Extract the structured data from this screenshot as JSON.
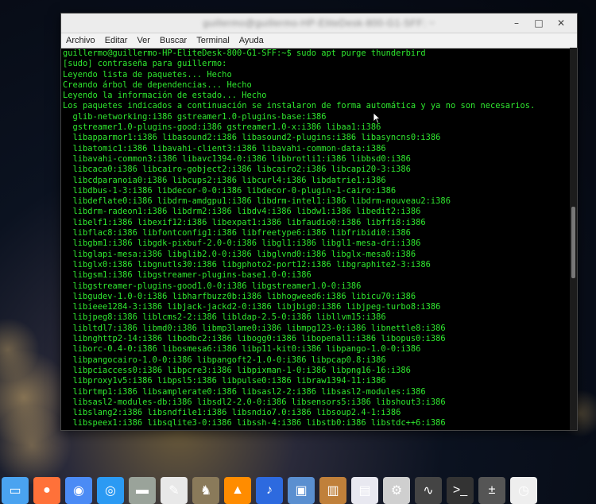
{
  "window": {
    "title_blurred": "guillermo@guillermo-HP-EliteDesk-800-G1-SFF: ~",
    "minimize_glyph": "–",
    "maximize_glyph": "□",
    "close_glyph": "✕"
  },
  "menu": [
    "Archivo",
    "Editar",
    "Ver",
    "Buscar",
    "Terminal",
    "Ayuda"
  ],
  "terminal": {
    "color": "#2fe82f",
    "lines": [
      "guillermo@guillermo-HP-EliteDesk-800-G1-SFF:~$ sudo apt purge thunderbird",
      "[sudo] contraseña para guillermo:",
      "Leyendo lista de paquetes... Hecho",
      "Creando árbol de dependencias... Hecho",
      "Leyendo la información de estado... Hecho",
      "Los paquetes indicados a continuación se instalaron de forma automática y ya no son necesarios.",
      "  glib-networking:i386 gstreamer1.0-plugins-base:i386",
      "  gstreamer1.0-plugins-good:i386 gstreamer1.0-x:i386 libaa1:i386",
      "  libapparmor1:i386 libasound2:i386 libasound2-plugins:i386 libasyncns0:i386",
      "  libatomic1:i386 libavahi-client3:i386 libavahi-common-data:i386",
      "  libavahi-common3:i386 libavc1394-0:i386 libbrotli1:i386 libbsd0:i386",
      "  libcaca0:i386 libcairo-gobject2:i386 libcairo2:i386 libcapi20-3:i386",
      "  libcdparanoia0:i386 libcups2:i386 libcurl4:i386 libdatrie1:i386",
      "  libdbus-1-3:i386 libdecor-0-0:i386 libdecor-0-plugin-1-cairo:i386",
      "  libdeflate0:i386 libdrm-amdgpu1:i386 libdrm-intel1:i386 libdrm-nouveau2:i386",
      "  libdrm-radeon1:i386 libdrm2:i386 libdv4:i386 libdw1:i386 libedit2:i386",
      "  libelf1:i386 libexif12:i386 libexpat1:i386 libfaudio0:i386 libffi8:i386",
      "  libflac8:i386 libfontconfig1:i386 libfreetype6:i386 libfribidi0:i386",
      "  libgbm1:i386 libgdk-pixbuf-2.0-0:i386 libgl1:i386 libgl1-mesa-dri:i386",
      "  libglapi-mesa:i386 libglib2.0-0:i386 libglvnd0:i386 libglx-mesa0:i386",
      "  libglx0:i386 libgnutls30:i386 libgphoto2-port12:i386 libgraphite2-3:i386",
      "  libgsm1:i386 libgstreamer-plugins-base1.0-0:i386",
      "  libgstreamer-plugins-good1.0-0:i386 libgstreamer1.0-0:i386",
      "  libgudev-1.0-0:i386 libharfbuzz0b:i386 libhogweed6:i386 libicu70:i386",
      "  libieee1284-3:i386 libjack-jackd2-0:i386 libjbig0:i386 libjpeg-turbo8:i386",
      "  libjpeg8:i386 liblcms2-2:i386 libldap-2.5-0:i386 libllvm15:i386",
      "  libltdl7:i386 libmd0:i386 libmp3lame0:i386 libmpg123-0:i386 libnettle8:i386",
      "  libnghttp2-14:i386 libodbc2:i386 libogg0:i386 libopenal1:i386 libopus0:i386",
      "  liborc-0.4-0:i386 libosmesa6:i386 libp11-kit0:i386 libpango-1.0-0:i386",
      "  libpangocairo-1.0-0:i386 libpangoft2-1.0-0:i386 libpcap0.8:i386",
      "  libpciaccess0:i386 libpcre3:i386 libpixman-1-0:i386 libpng16-16:i386",
      "  libproxy1v5:i386 libpsl5:i386 libpulse0:i386 libraw1394-11:i386",
      "  librtmp1:i386 libsamplerate0:i386 libsasl2-2:i386 libsasl2-modules:i386",
      "  libsasl2-modules-db:i386 libsdl2-2.0-0:i386 libsensors5:i386 libshout3:i386",
      "  libslang2:i386 libsndfile1:i386 libsndio7.0:i386 libsoup2.4-1:i386",
      "  libspeex1:i386 libsqlite3-0:i386 libssh-4:i386 libstb0:i386 libstdc++6:i386"
    ]
  },
  "dock": [
    {
      "name": "files-icon",
      "glyph": "▭",
      "color": "#4aa3f0"
    },
    {
      "name": "firefox-icon",
      "glyph": "●",
      "color": "#ff7139"
    },
    {
      "name": "chromium-icon",
      "glyph": "◉",
      "color": "#4b8bf5"
    },
    {
      "name": "browser-icon",
      "glyph": "◎",
      "color": "#2b9af3"
    },
    {
      "name": "file-manager-icon",
      "glyph": "▬",
      "color": "#9aa39a"
    },
    {
      "name": "text-editor-icon",
      "glyph": "✎",
      "color": "#e8e8e8"
    },
    {
      "name": "gimp-icon",
      "glyph": "♞",
      "color": "#8a7a5a"
    },
    {
      "name": "vlc-icon",
      "glyph": "▲",
      "color": "#ff8c00"
    },
    {
      "name": "audio-editor-icon",
      "glyph": "♪",
      "color": "#2d6adf"
    },
    {
      "name": "image-viewer-icon",
      "glyph": "▣",
      "color": "#5a8fd0"
    },
    {
      "name": "library-icon",
      "glyph": "▥",
      "color": "#c0803a"
    },
    {
      "name": "document-viewer-icon",
      "glyph": "▤",
      "color": "#e8e8f0"
    },
    {
      "name": "settings-icon",
      "glyph": "⚙",
      "color": "#cfcfcf"
    },
    {
      "name": "system-monitor-icon",
      "glyph": "∿",
      "color": "#444"
    },
    {
      "name": "terminal-icon",
      "glyph": ">_",
      "color": "#333"
    },
    {
      "name": "calculator-icon",
      "glyph": "±",
      "color": "#555"
    },
    {
      "name": "clock-icon",
      "glyph": "◷",
      "color": "#eee"
    }
  ]
}
